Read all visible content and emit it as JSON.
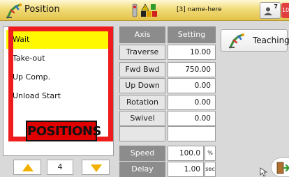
{
  "header": {
    "title": "Position",
    "status_text": "[3] name-here",
    "user_count": "7",
    "alarm_badge": "100"
  },
  "positions_list": {
    "items": [
      {
        "label": "Wait",
        "selected": true
      },
      {
        "label": "Take-out",
        "selected": false
      },
      {
        "label": "Up Comp.",
        "selected": false
      },
      {
        "label": "Unload Start",
        "selected": false
      }
    ],
    "annotation": "POSITIONS",
    "page": "4"
  },
  "axis_table": {
    "header_axis": "Axis",
    "header_setting": "Setting",
    "rows": [
      {
        "axis": "Traverse",
        "value": "10.00"
      },
      {
        "axis": "Fwd Bwd",
        "value": "750.00"
      },
      {
        "axis": "Up Down",
        "value": "0.00"
      },
      {
        "axis": "Rotation",
        "value": "0.00"
      },
      {
        "axis": "Swivel",
        "value": "0.00"
      },
      {
        "axis": "",
        "value": ""
      }
    ]
  },
  "motion": {
    "speed_label": "Speed",
    "speed_value": "100.0",
    "speed_unit": "%",
    "delay_label": "Delay",
    "delay_value": "1.00",
    "delay_unit": "sec"
  },
  "teaching": {
    "label": "Teaching"
  },
  "colors": {
    "selected_row": "#fff800",
    "annotation_red": "#ee1c1c",
    "header_gray": "#8c8c8c",
    "arrow_yellow": "#f2b100"
  }
}
